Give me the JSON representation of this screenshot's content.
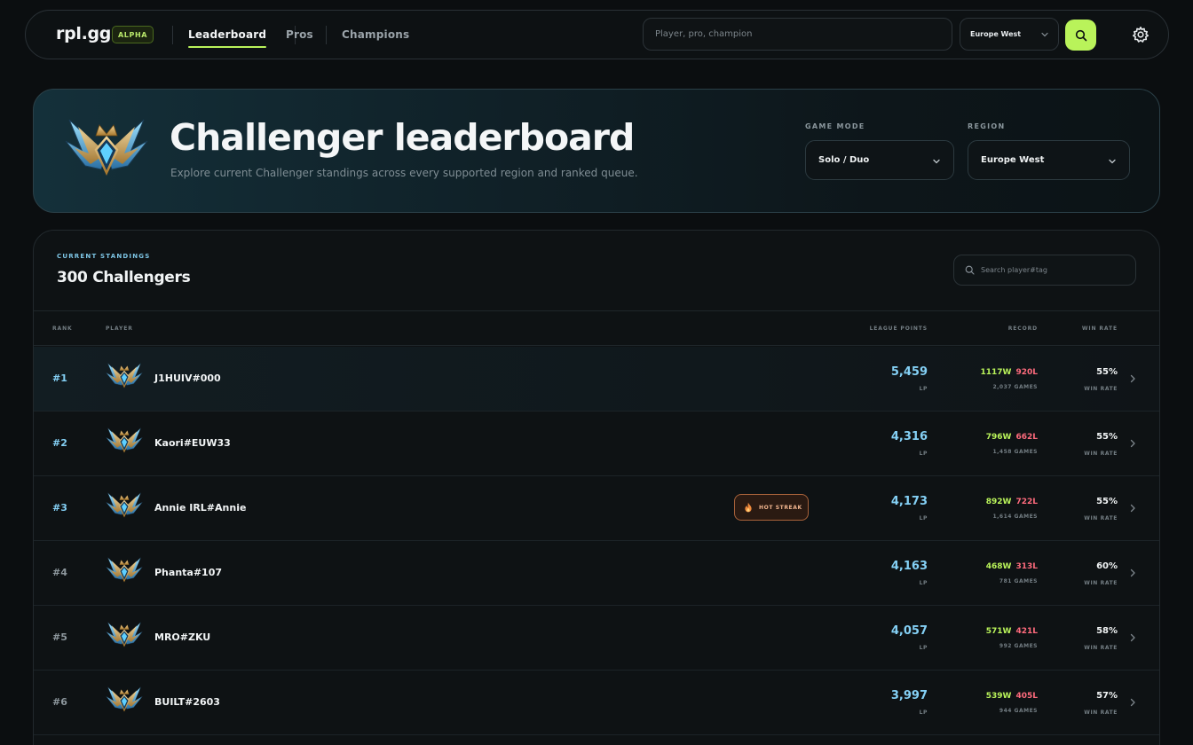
{
  "nav": {
    "logo": "rpl.gg",
    "badge": "ALPHA",
    "links": [
      "Leaderboard",
      "Pros",
      "Champions"
    ],
    "search_placeholder": "Player, pro, champion",
    "region": "Europe West",
    "icons": [
      "search-icon",
      "gear-icon",
      "chevron-down-icon"
    ]
  },
  "hero": {
    "title": "Challenger leaderboard",
    "subtitle": "Explore current Challenger standings across every supported region and ranked queue.",
    "game_mode_label": "GAME MODE",
    "game_mode": "Solo / Duo",
    "region_label": "REGION",
    "region": "Europe West"
  },
  "standings": {
    "eyebrow": "CURRENT STANDINGS",
    "count": "300 Challengers",
    "search_placeholder": "Search player#tag",
    "columns": {
      "rank": "RANK",
      "player": "PLAYER",
      "lp": "LEAGUE POINTS",
      "record": "RECORD",
      "winrate": "WIN RATE"
    },
    "rows": [
      {
        "rank": "#1",
        "name": "J1HUIV#000",
        "lp": "5,459",
        "lp_unit": "LP",
        "wins": "1117W",
        "losses": "920L",
        "games": "2,037 GAMES",
        "winrate": "55%",
        "winrate_unit": "WIN RATE",
        "badge": ""
      },
      {
        "rank": "#2",
        "name": "Kaori#EUW33",
        "lp": "4,316",
        "lp_unit": "LP",
        "wins": "796W",
        "losses": "662L",
        "games": "1,458 GAMES",
        "winrate": "55%",
        "winrate_unit": "WIN RATE",
        "badge": ""
      },
      {
        "rank": "#3",
        "name": "Annie IRL#Annie",
        "lp": "4,173",
        "lp_unit": "LP",
        "wins": "892W",
        "losses": "722L",
        "games": "1,614 GAMES",
        "winrate": "55%",
        "winrate_unit": "WIN RATE",
        "badge": "HOT STREAK"
      },
      {
        "rank": "#4",
        "name": "Phanta#107",
        "lp": "4,163",
        "lp_unit": "LP",
        "wins": "468W",
        "losses": "313L",
        "games": "781 GAMES",
        "winrate": "60%",
        "winrate_unit": "WIN RATE",
        "badge": ""
      },
      {
        "rank": "#5",
        "name": "MRO#ZKU",
        "lp": "4,057",
        "lp_unit": "LP",
        "wins": "571W",
        "losses": "421L",
        "games": "992 GAMES",
        "winrate": "58%",
        "winrate_unit": "WIN RATE",
        "badge": ""
      },
      {
        "rank": "#6",
        "name": "BUILT#2603",
        "lp": "3,997",
        "lp_unit": "LP",
        "wins": "539W",
        "losses": "405L",
        "games": "944 GAMES",
        "winrate": "57%",
        "winrate_unit": "WIN RATE",
        "badge": ""
      }
    ]
  },
  "colors": {
    "accent": "#b9f35a",
    "lp": "#84d0f5",
    "loss": "#ff6b7d",
    "top_rank": "#84d0f5",
    "rank": "#8d979d"
  }
}
